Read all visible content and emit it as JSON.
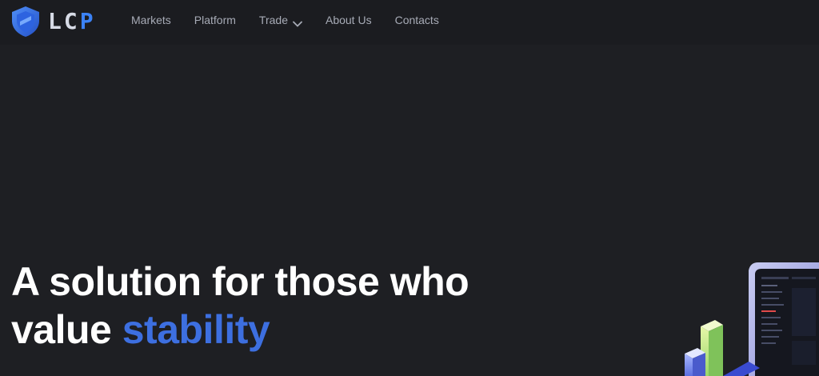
{
  "header": {
    "logo": {
      "text_main": "LC",
      "text_accent": "P",
      "icon": "shield-icon"
    },
    "nav": [
      {
        "label": "Markets"
      },
      {
        "label": "Platform"
      },
      {
        "label": "Trade",
        "icon": "chevron-down-icon"
      },
      {
        "label": "About Us"
      },
      {
        "label": "Contacts"
      }
    ]
  },
  "hero": {
    "title_line1": "A solution for those who",
    "title_line2_prefix": "value ",
    "title_highlight": "stability"
  },
  "colors": {
    "background": "#1e1f23",
    "header_bg": "#1b1c20",
    "accent": "#3d6fe0",
    "nav_text": "#a7abb6"
  }
}
